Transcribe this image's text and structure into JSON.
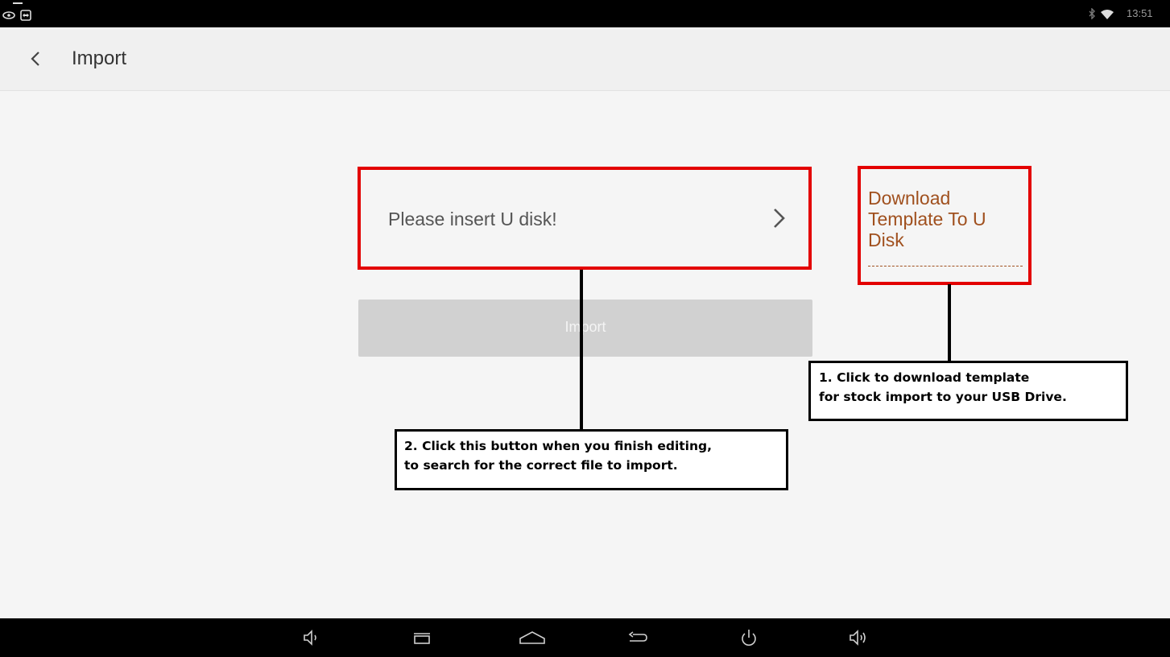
{
  "status_bar": {
    "time": "13:51",
    "icons": [
      "eye-icon",
      "teamviewer-icon",
      "bluetooth-icon",
      "wifi-icon"
    ]
  },
  "toolbar": {
    "back_icon": "chevron-left-icon",
    "title": "Import"
  },
  "main": {
    "usb_placeholder": "Please insert U disk!",
    "usb_chevron_icon": "chevron-right-icon",
    "import_button_label": "Import",
    "download_link_text": "Download Template To U Disk"
  },
  "callouts": {
    "step1_line1": "1. Click to download template",
    "step1_line2": "for stock import to your USB Drive.",
    "step2_line1": "2. Click this button when you finish editing,",
    "step2_line2": "to search for the correct file to import."
  },
  "nav_bar": {
    "icons": [
      "volume-down-icon",
      "recent-apps-icon",
      "home-icon",
      "back-icon",
      "power-icon",
      "volume-up-icon"
    ]
  },
  "colors": {
    "highlight_border": "#e30000",
    "link": "#a0501e",
    "button_disabled": "#d1d1d1"
  }
}
